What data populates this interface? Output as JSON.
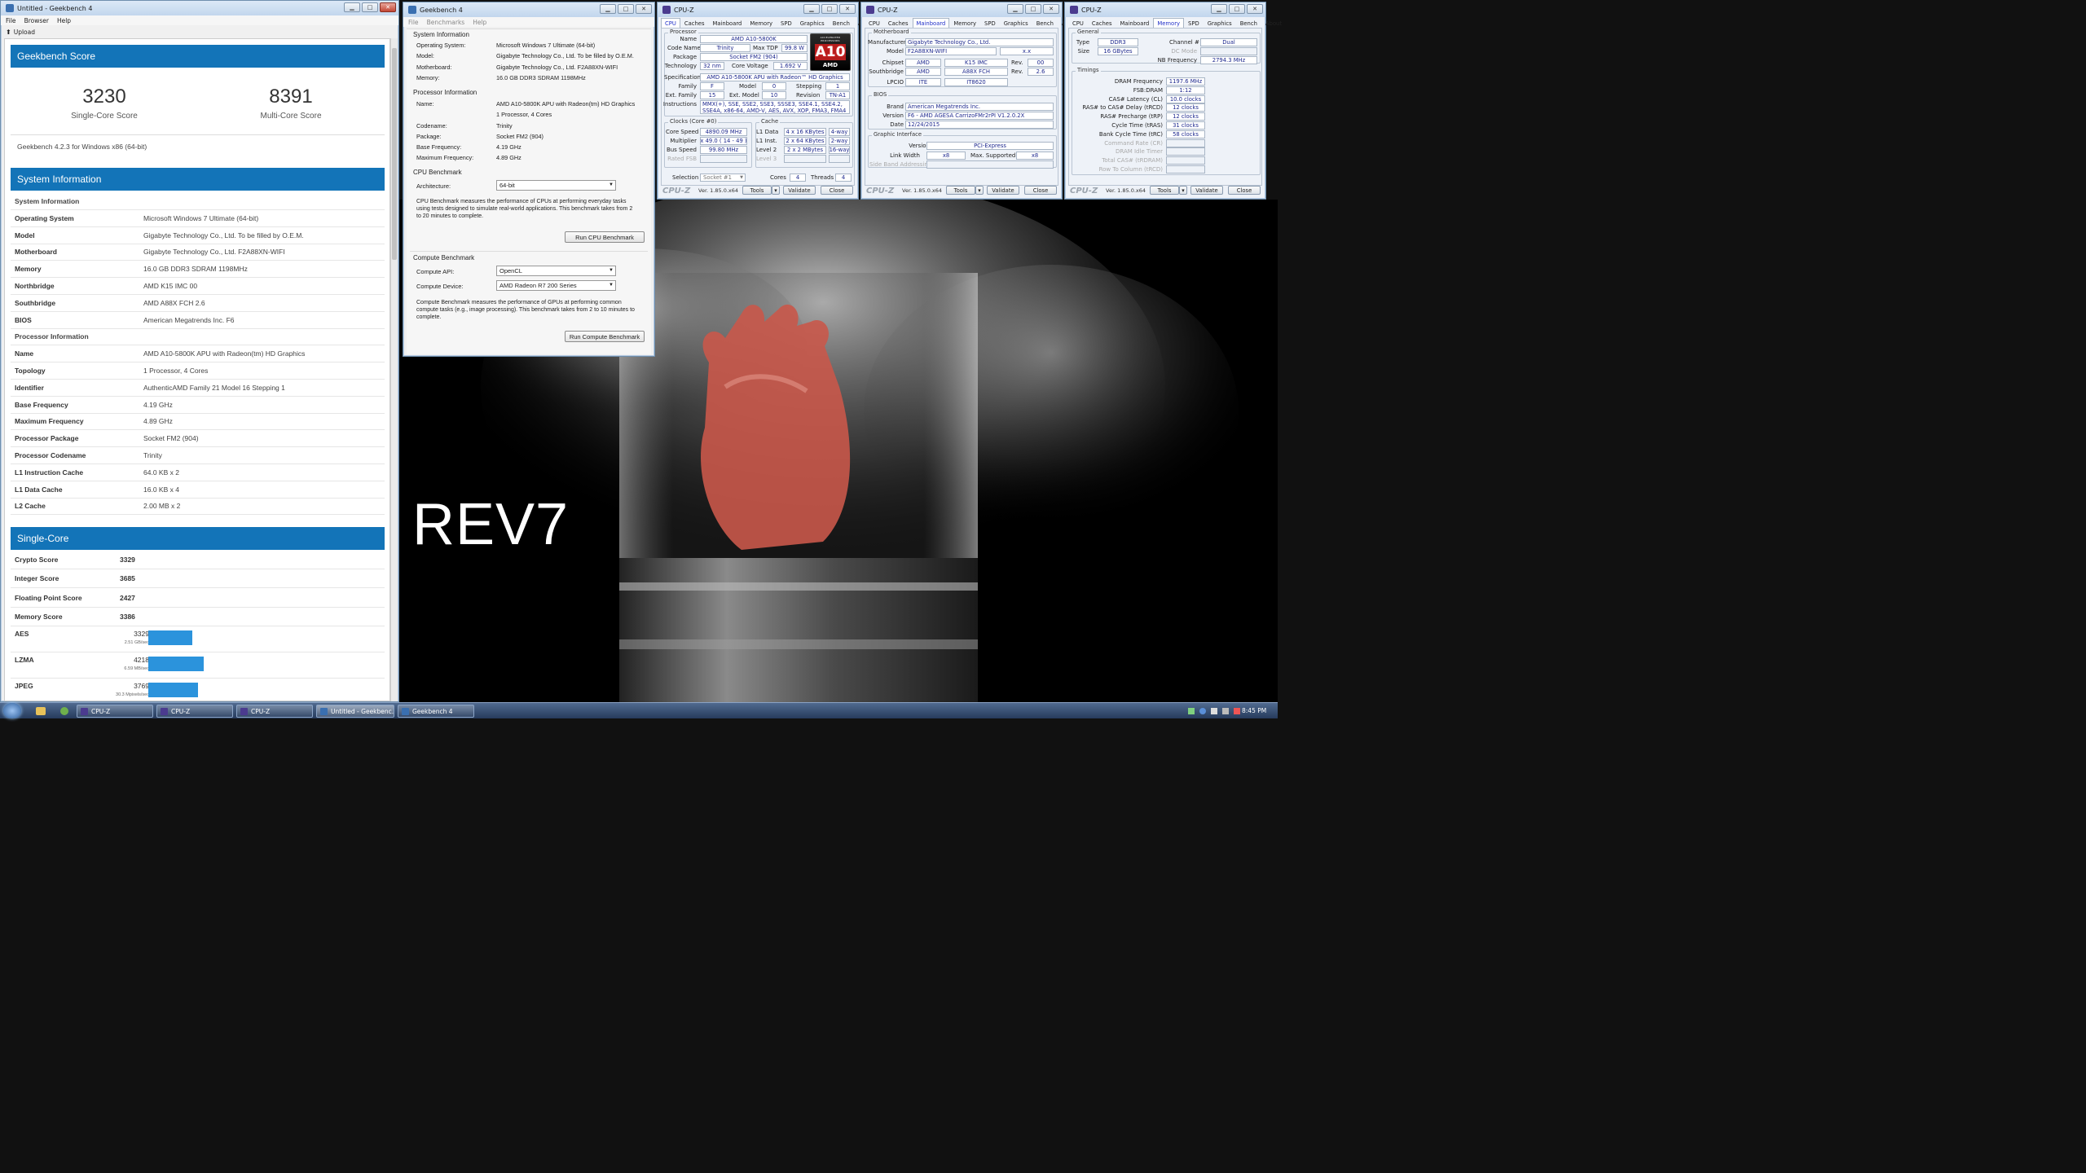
{
  "gb_main": {
    "title": "Untitled - Geekbench 4",
    "menu": [
      "File",
      "Browser",
      "Help"
    ],
    "upload_label": "Upload",
    "score_header": "Geekbench Score",
    "single_score": "3230",
    "single_label": "Single-Core Score",
    "multi_score": "8391",
    "multi_label": "Multi-Core Score",
    "version": "Geekbench 4.2.3 for Windows x86 (64-bit)",
    "sysinfo_header": "System Information",
    "sysinfo_rows": [
      {
        "k": "System Information",
        "v": ""
      },
      {
        "k": "Operating System",
        "v": "Microsoft Windows 7 Ultimate (64-bit)"
      },
      {
        "k": "Model",
        "v": "Gigabyte Technology Co., Ltd. To be filled by O.E.M."
      },
      {
        "k": "Motherboard",
        "v": "Gigabyte Technology Co., Ltd. F2A88XN-WIFI"
      },
      {
        "k": "Memory",
        "v": "16.0 GB DDR3 SDRAM 1198MHz"
      },
      {
        "k": "Northbridge",
        "v": "AMD K15 IMC 00"
      },
      {
        "k": "Southbridge",
        "v": "AMD A88X FCH 2.6"
      },
      {
        "k": "BIOS",
        "v": "American Megatrends Inc. F6"
      },
      {
        "k": "Processor Information",
        "v": ""
      },
      {
        "k": "Name",
        "v": "AMD A10-5800K APU with Radeon(tm) HD Graphics"
      },
      {
        "k": "Topology",
        "v": "1 Processor, 4 Cores"
      },
      {
        "k": "Identifier",
        "v": "AuthenticAMD Family 21 Model 16 Stepping 1"
      },
      {
        "k": "Base Frequency",
        "v": "4.19 GHz"
      },
      {
        "k": "Maximum Frequency",
        "v": "4.89 GHz"
      },
      {
        "k": "Processor Package",
        "v": "Socket FM2 (904)"
      },
      {
        "k": "Processor Codename",
        "v": "Trinity"
      },
      {
        "k": "L1 Instruction Cache",
        "v": "64.0 KB x 2"
      },
      {
        "k": "L1 Data Cache",
        "v": "16.0 KB x 4"
      },
      {
        "k": "L2 Cache",
        "v": "2.00 MB x 2"
      }
    ],
    "single_header": "Single-Core",
    "single_rows": [
      {
        "k": "Crypto Score",
        "v": "3329"
      },
      {
        "k": "Integer Score",
        "v": "3685"
      },
      {
        "k": "Floating Point Score",
        "v": "2427"
      },
      {
        "k": "Memory Score",
        "v": "3386"
      }
    ],
    "bench_rows": [
      {
        "k": "AES",
        "v": "3329",
        "sub": "2.51 GB/sec",
        "level": 0.79
      },
      {
        "k": "LZMA",
        "v": "4218",
        "sub": "6.59 MB/sec",
        "level": 1.0
      },
      {
        "k": "JPEG",
        "v": "3769",
        "sub": "30.3 Mpixels/sec",
        "level": 0.89
      }
    ]
  },
  "gb_second": {
    "title": "Geekbench 4",
    "menu": [
      "File",
      "Benchmarks",
      "Help"
    ],
    "sys_header": "System Information",
    "sys_rows": [
      {
        "k": "Operating System:",
        "v": "Microsoft Windows 7 Ultimate (64-bit)"
      },
      {
        "k": "Model:",
        "v": "Gigabyte Technology Co., Ltd. To be filled by O.E.M."
      },
      {
        "k": "Motherboard:",
        "v": "Gigabyte Technology Co., Ltd. F2A88XN-WIFI"
      },
      {
        "k": "Memory:",
        "v": "16.0 GB DDR3 SDRAM 1198MHz"
      }
    ],
    "proc_header": "Processor Information",
    "proc_rows": [
      {
        "k": "Name:",
        "v": "AMD A10-5800K APU with Radeon(tm) HD Graphics"
      },
      {
        "k": "",
        "v": "1 Processor, 4 Cores"
      },
      {
        "k": "Codename:",
        "v": "Trinity"
      },
      {
        "k": "Package:",
        "v": "Socket FM2 (904)"
      },
      {
        "k": "Base Frequency:",
        "v": "4.19 GHz"
      },
      {
        "k": "Maximum Frequency:",
        "v": "4.89 GHz"
      }
    ],
    "cpu_bench_header": "CPU Benchmark",
    "arch_label": "Architecture:",
    "arch_value": "64-bit",
    "cpu_desc": "CPU Benchmark measures the performance of CPUs at performing everyday tasks using tests designed to simulate real-world applications. This benchmark takes from 2 to 20 minutes to complete.",
    "run_cpu": "Run CPU Benchmark",
    "compute_header": "Compute Benchmark",
    "api_label": "Compute API:",
    "api_value": "OpenCL",
    "device_label": "Compute Device:",
    "device_value": "AMD Radeon R7 200 Series",
    "compute_desc": "Compute Benchmark measures the performance of GPUs at performing common compute tasks (e.g., image processing). This benchmark takes from 2 to 10 minutes to complete.",
    "run_compute": "Run Compute Benchmark"
  },
  "cpuz_common": {
    "title": "CPU-Z",
    "tabs": [
      "CPU",
      "Caches",
      "Mainboard",
      "Memory",
      "SPD",
      "Graphics",
      "Bench",
      "About"
    ],
    "logo": "CPU-Z",
    "version": "Ver. 1.85.0.x64",
    "tools": "Tools",
    "validate": "Validate",
    "close": "Close"
  },
  "cpuz_cpu": {
    "processor_group": "Processor",
    "name_l": "Name",
    "name": "AMD A10-5800K",
    "codename_l": "Code Name",
    "codename": "Trinity",
    "maxtdp_l": "Max TDP",
    "maxtdp": "99.8 W",
    "package_l": "Package",
    "package": "Socket FM2 (904)",
    "tech_l": "Technology",
    "tech": "32 nm",
    "cv_l": "Core Voltage",
    "cv": "1.692 V",
    "spec_l": "Specification",
    "spec": "AMD A10-5800K APU with Radeon™ HD Graphics",
    "family_l": "Family",
    "family": "F",
    "model_l": "Model",
    "model": "0",
    "stepping_l": "Stepping",
    "stepping": "1",
    "extfam_l": "Ext. Family",
    "extfam": "15",
    "extmod_l": "Ext. Model",
    "extmod": "10",
    "rev_l": "Revision",
    "rev": "TN-A1",
    "instr_l": "Instructions",
    "instr": "MMX(+), SSE, SSE2, SSE3, SSSE3, SSE4.1, SSE4.2, SSE4A, x86-64, AMD-V, AES, AVX, XOP, FMA3, FMA4",
    "badge_top": "ACCELERATED PROCESSORS",
    "badge": "A10",
    "badge_brand": "AMD",
    "clocks_group": "Clocks (Core #0)",
    "cs_l": "Core Speed",
    "cs": "4890.09 MHz",
    "mult_l": "Multiplier",
    "mult": "x 49.0 ( 14 - 49 )",
    "bus_l": "Bus Speed",
    "bus": "99.80 MHz",
    "fsb_l": "Rated FSB",
    "fsb": "",
    "cache_group": "Cache",
    "l1d_l": "L1 Data",
    "l1d": "4 x 16 KBytes",
    "l1d_w": "4-way",
    "l1i_l": "L1 Inst.",
    "l1i": "2 x 64 KBytes",
    "l1i_w": "2-way",
    "l2_l": "Level 2",
    "l2": "2 x 2 MBytes",
    "l2_w": "16-way",
    "l3_l": "Level 3",
    "l3": "",
    "l3_w": "",
    "sel_l": "Selection",
    "sel": "Socket #1",
    "cores_l": "Cores",
    "cores": "4",
    "threads_l": "Threads",
    "threads": "4"
  },
  "cpuz_mb": {
    "mb_group": "Motherboard",
    "manu_l": "Manufacturer",
    "manu": "Gigabyte Technology Co., Ltd.",
    "model_l": "Model",
    "model": "F2A88XN-WIFI",
    "model_rev": "x.x",
    "chipset_l": "Chipset",
    "chipset": "AMD",
    "chipset2": "K15 IMC",
    "chipset_rev_l": "Rev.",
    "chipset_rev": "00",
    "south_l": "Southbridge",
    "south": "AMD",
    "south2": "A88X FCH",
    "south_rev_l": "Rev.",
    "south_rev": "2.6",
    "lpcio_l": "LPCIO",
    "lpcio": "ITE",
    "lpcio2": "IT8620",
    "bios_group": "BIOS",
    "brand_l": "Brand",
    "brand": "American Megatrends Inc.",
    "ver_l": "Version",
    "ver": "F6 - AMD AGESA CarrizoFMr2rPI  V1.2.0.2X",
    "date_l": "Date",
    "date": "12/24/2015",
    "gi_group": "Graphic Interface",
    "gver_l": "Version",
    "gver": "PCI-Express",
    "lw_l": "Link Width",
    "lw": "x8",
    "ms_l": "Max. Supported",
    "ms": "x8",
    "sba_l": "Side Band Addressing",
    "sba": ""
  },
  "cpuz_mem": {
    "gen_group": "General",
    "type_l": "Type",
    "type": "DDR3",
    "chan_l": "Channel #",
    "chan": "Dual",
    "size_l": "Size",
    "size": "16 GBytes",
    "dc_l": "DC Mode",
    "dc": "",
    "nb_l": "NB Frequency",
    "nb": "2794.3 MHz",
    "tim_group": "Timings",
    "timings": [
      {
        "k": "DRAM Frequency",
        "v": "1197.6 MHz",
        "dim": false
      },
      {
        "k": "FSB:DRAM",
        "v": "1:12",
        "dim": false
      },
      {
        "k": "CAS# Latency (CL)",
        "v": "10.0 clocks",
        "dim": false
      },
      {
        "k": "RAS# to CAS# Delay (tRCD)",
        "v": "12 clocks",
        "dim": false
      },
      {
        "k": "RAS# Precharge (tRP)",
        "v": "12 clocks",
        "dim": false
      },
      {
        "k": "Cycle Time (tRAS)",
        "v": "31 clocks",
        "dim": false
      },
      {
        "k": "Bank Cycle Time (tRC)",
        "v": "58 clocks",
        "dim": false
      },
      {
        "k": "Command Rate (CR)",
        "v": "",
        "dim": true
      },
      {
        "k": "DRAM Idle Timer",
        "v": "",
        "dim": true
      },
      {
        "k": "Total CAS# (tRDRAM)",
        "v": "",
        "dim": true
      },
      {
        "k": "Row To Column (tRCD)",
        "v": "",
        "dim": true
      }
    ]
  },
  "wallpaper": {
    "text": "REV7"
  },
  "taskbar": {
    "items": [
      "CPU-Z",
      "CPU-Z",
      "CPU-Z",
      "Untitled - Geekbenc...",
      "Geekbench 4"
    ],
    "time": "8:45 PM"
  },
  "colors": {
    "accent": "#1374b8",
    "bar": "#2b93dc",
    "cpuz_value": "#1f2a8f"
  }
}
